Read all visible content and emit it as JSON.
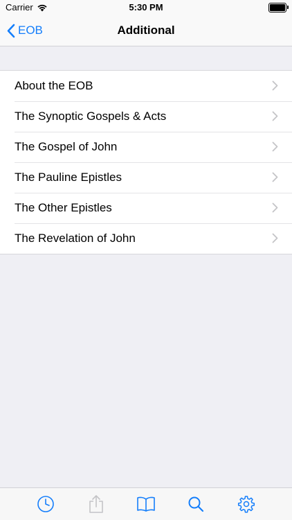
{
  "status_bar": {
    "carrier": "Carrier",
    "time": "5:30 PM"
  },
  "nav": {
    "back_label": "EOB",
    "title": "Additional"
  },
  "list": {
    "items": [
      {
        "label": "About the EOB"
      },
      {
        "label": "The Synoptic Gospels & Acts"
      },
      {
        "label": "The Gospel of John"
      },
      {
        "label": "The Pauline Epistles"
      },
      {
        "label": "The Other Epistles"
      },
      {
        "label": "The Revelation of John"
      }
    ]
  },
  "tab_bar": {
    "tabs": [
      {
        "icon": "clock-icon"
      },
      {
        "icon": "share-icon"
      },
      {
        "icon": "book-icon"
      },
      {
        "icon": "search-icon"
      },
      {
        "icon": "gear-icon"
      }
    ]
  },
  "colors": {
    "accent": "#147efb",
    "background": "#efeff4"
  }
}
